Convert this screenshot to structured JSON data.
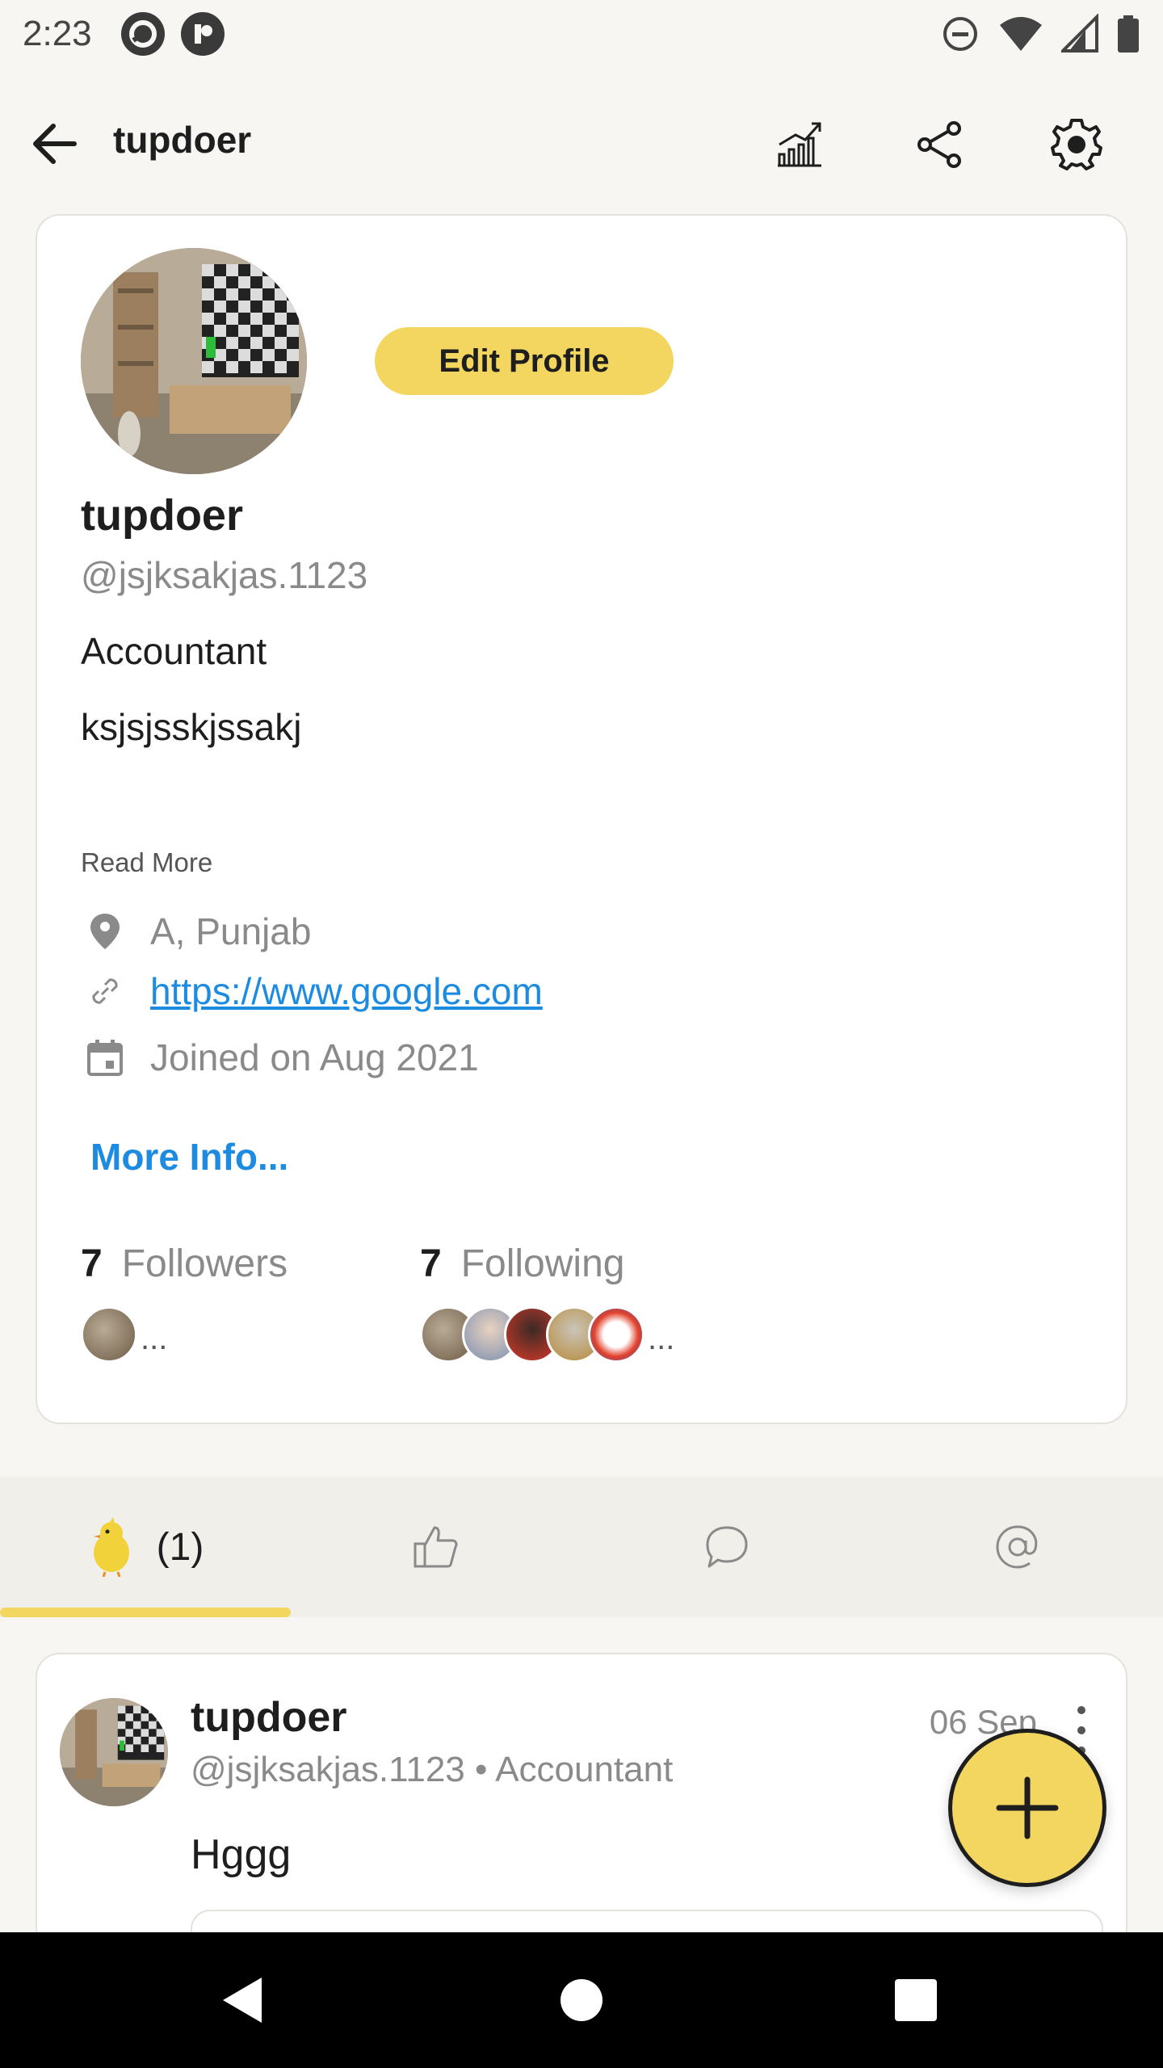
{
  "status_bar": {
    "time": "2:23"
  },
  "header": {
    "title": "tupdoer",
    "icons": [
      "back-arrow-icon",
      "stats-icon",
      "share-icon",
      "settings-icon"
    ]
  },
  "profile": {
    "edit_label": "Edit Profile",
    "name": "tupdoer",
    "handle": "@jsjksakjas.1123",
    "bio_lines": [
      "Accountant",
      "ksjsjsskjssakj"
    ],
    "read_more": "Read More",
    "location": "A, Punjab",
    "website": "https://www.google.com",
    "joined": "Joined on Aug 2021",
    "more_info": "More Info...",
    "followers": {
      "count": "7",
      "label": "Followers",
      "ellipsis": "..."
    },
    "following": {
      "count": "7",
      "label": "Following",
      "ellipsis": "..."
    }
  },
  "tabs": {
    "posts_count": "(1)",
    "items": [
      "chick-icon",
      "thumbs-up-icon",
      "comment-icon",
      "at-icon"
    ]
  },
  "post": {
    "author": "tupdoer",
    "meta": "@jsjksakjas.1123 • Accountant",
    "date": "06 Sep",
    "text": "Hggg"
  },
  "colors": {
    "accent": "#f2d660",
    "link": "#1d8ce0",
    "muted": "#8a8a8a"
  }
}
